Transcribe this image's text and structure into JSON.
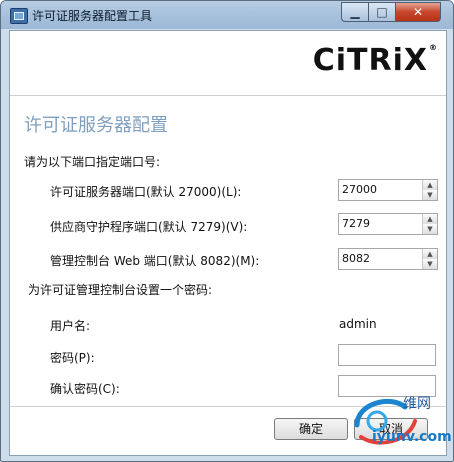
{
  "window": {
    "title": "许可证服务器配置工具",
    "buttons": {
      "minimize": "▁",
      "maximize": "□",
      "close": "✕"
    }
  },
  "logo": {
    "text": "CiTRiX",
    "registered": "®"
  },
  "header": {
    "title": "许可证服务器配置"
  },
  "ports": {
    "section_label": "请为以下端口指定端口号:",
    "fields": [
      {
        "label": "许可证服务器端口(默认 27000)(L):",
        "value": "27000"
      },
      {
        "label": "供应商守护程序端口(默认 7279)(V):",
        "value": "7279"
      },
      {
        "label": "管理控制台 Web 端口(默认 8082)(M):",
        "value": "8082"
      }
    ]
  },
  "password": {
    "section_label": "为许可证管理控制台设置一个密码:",
    "username_label": "用户名:",
    "username_value": "admin",
    "password_label": "密码(P):",
    "password_value": "",
    "confirm_label": "确认密码(C):",
    "confirm_value": ""
  },
  "footer": {
    "ok_label": "确定",
    "cancel_label": "取消"
  },
  "watermark": {
    "text": "iyunv.com",
    "cn_text": "维网"
  },
  "colors": {
    "title_bar": "#a6c0db",
    "close_button": "#c7462c",
    "header_title": "#7f9fc0",
    "watermark": "#1879c7"
  }
}
